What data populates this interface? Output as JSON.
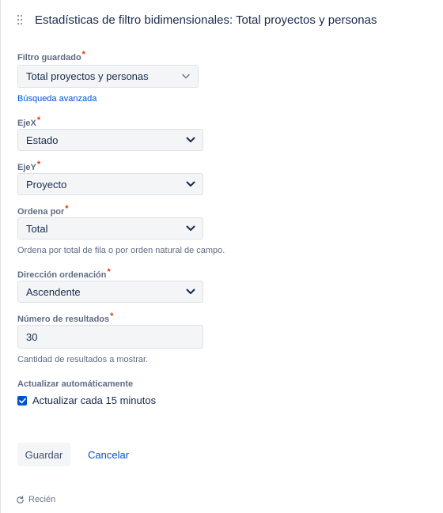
{
  "header": {
    "title": "Estadísticas de filtro bidimensionales: Total proyectos y personas"
  },
  "form": {
    "saved_filter": {
      "label": "Filtro guardado",
      "required": "*",
      "value": "Total proyectos y personas",
      "advanced_search_link": "Búsqueda avanzada"
    },
    "x_axis": {
      "label": "EjeX",
      "required": "*",
      "value": "Estado"
    },
    "y_axis": {
      "label": "EjeY",
      "required": "*",
      "value": "Proyecto"
    },
    "sort_by": {
      "label": "Ordena por",
      "required": "*",
      "value": "Total",
      "help": "Ordena por total de fila o por orden natural de campo."
    },
    "sort_direction": {
      "label": "Dirección ordenación",
      "required": "*",
      "value": "Ascendente"
    },
    "num_results": {
      "label": "Número de resultados",
      "required": "*",
      "value": "30",
      "help": "Cantidad de resultados a mostrar."
    },
    "auto_refresh": {
      "label": "Actualizar automáticamente",
      "checkbox_label": "Actualizar cada 15 minutos",
      "checked": true
    }
  },
  "actions": {
    "save_label": "Guardar",
    "cancel_label": "Cancelar"
  },
  "footer": {
    "refresh_text": "Recién"
  },
  "colors": {
    "accent": "#0052cc",
    "required": "#de350b",
    "field_bg": "#f4f5f7"
  },
  "icons": {
    "drag": "drag-handle-icon",
    "chevron": "chevron-down-icon",
    "check": "checkmark-icon",
    "refresh": "refresh-icon"
  }
}
